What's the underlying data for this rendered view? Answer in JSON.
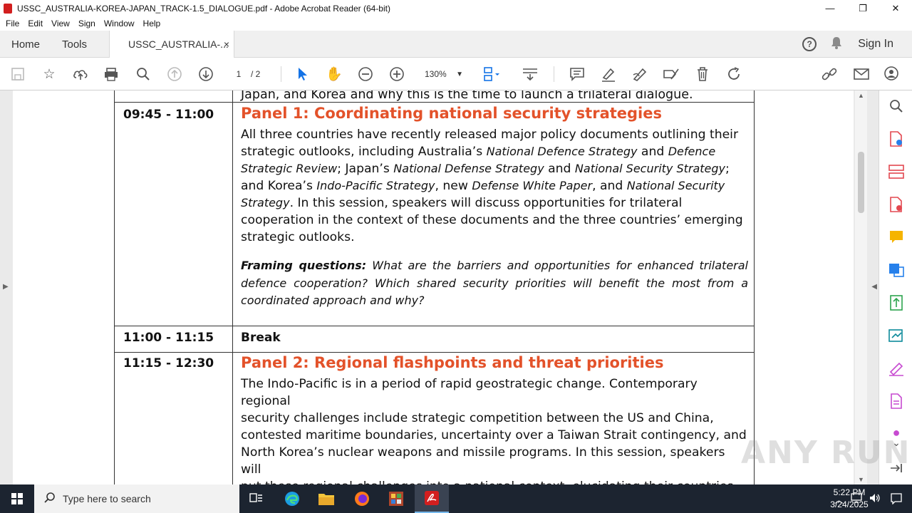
{
  "window": {
    "title": "USSC_AUSTRALIA-KOREA-JAPAN_TRACK-1.5_DIALOGUE.pdf - Adobe Acrobat Reader (64-bit)",
    "minimize": "—",
    "maximize": "❐",
    "close": "✕"
  },
  "menu": [
    "File",
    "Edit",
    "View",
    "Sign",
    "Window",
    "Help"
  ],
  "tabs": {
    "home": "Home",
    "tools": "Tools",
    "doc": "USSC_AUSTRALIA-...",
    "doc_close": "×",
    "signin": "Sign In",
    "help": "?"
  },
  "toolbar": {
    "page_current": "1",
    "page_total": "/ 2",
    "zoom": "130%"
  },
  "agenda": {
    "intro_tail": "Japan, and Korea and why this is the time to launch a trilateral dialogue.",
    "panel1": {
      "time": "09:45 - 11:00",
      "title": "Panel 1: Coordinating national security strategies",
      "p1": "All three countries have recently released major policy documents outlining their",
      "p2a": "strategic outlooks, including Australia’s ",
      "p2i": "National Defence Strategy",
      "p2b": " and ",
      "p2i2": "Defence",
      "p3i": "Strategic Review",
      "p3a": "; Japan’s ",
      "p3i2": "National Defense Strategy",
      "p3b": " and ",
      "p3i3": "National Security Strategy",
      "p3c": ";",
      "p4a": "and Korea’s ",
      "p4i": "Indo-Pacific Strategy",
      "p4b": ", new ",
      "p4i2": "Defense White Paper",
      "p4c": ", and ",
      "p4i3": "National Security",
      "p5i": "Strategy",
      "p5a": ". In this session, speakers will discuss opportunities for trilateral",
      "p6": "cooperation in the context of these documents and the three countries’ emerging",
      "p7": "strategic outlooks.",
      "fq_label": "Framing questions:",
      "fq_text": " What are the barriers and opportunities for enhanced trilateral defence cooperation? Which shared security priorities will benefit the most from a coordinated approach and why?"
    },
    "break": {
      "time": "11:00 - 11:15",
      "label": "Break"
    },
    "panel2": {
      "time": "11:15 - 12:30",
      "title": "Panel 2: Regional flashpoints and threat priorities",
      "l1": "The Indo-Pacific is in a period of rapid geostrategic change. Contemporary regional",
      "l2": "security challenges include strategic competition between the US and China,",
      "l3": "contested maritime boundaries, uncertainty over a Taiwan Strait contingency, and",
      "l4": "North Korea’s nuclear weapons and missile programs. In this session, speakers will",
      "l5": "put these regional challenges into a national context, elucidating their countries"
    }
  },
  "watermark": "ANY RUN",
  "taskbar": {
    "search_placeholder": "Type here to search",
    "time": "5:22 PM",
    "date": "3/24/2025"
  },
  "colors": {
    "panel_title": "#e3522a",
    "accent": "#1473e6",
    "taskbar": "#1c2430"
  }
}
